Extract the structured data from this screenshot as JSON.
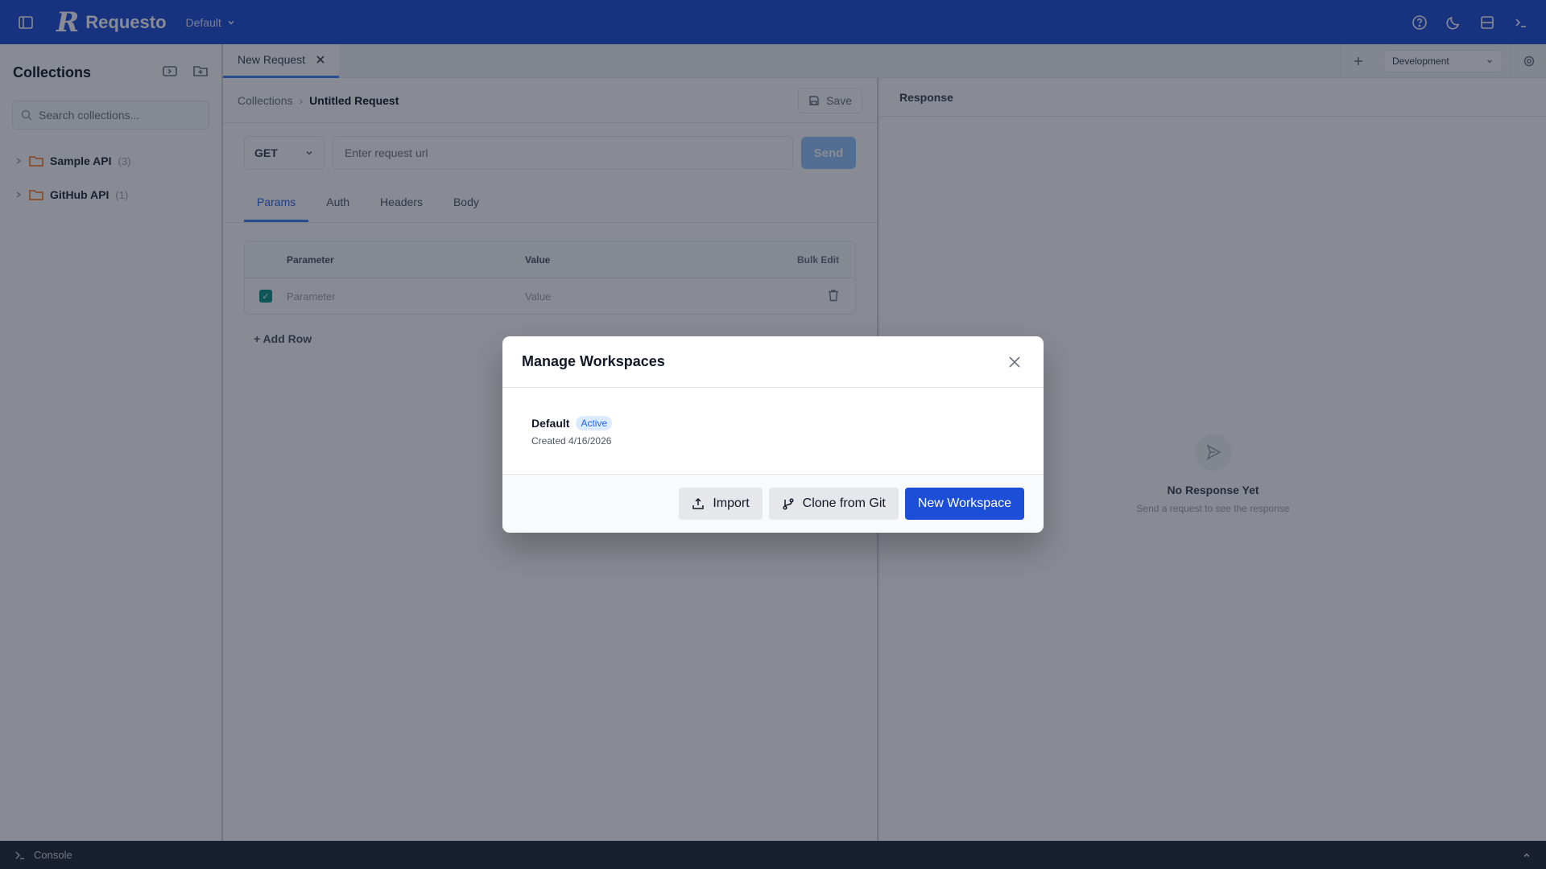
{
  "app": {
    "name": "Requesto",
    "workspace": "Default"
  },
  "sidebar": {
    "title": "Collections",
    "search_placeholder": "Search collections...",
    "items": [
      {
        "label": "Sample API",
        "count": "(3)"
      },
      {
        "label": "GitHub API",
        "count": "(1)"
      }
    ]
  },
  "tabs": [
    {
      "label": "New Request"
    }
  ],
  "environment": {
    "selected": "Development"
  },
  "request": {
    "breadcrumb": [
      "Collections",
      "Untitled Request"
    ],
    "save_label": "Save",
    "method": "GET",
    "url_placeholder": "Enter request url",
    "send_label": "Send",
    "tabs": [
      "Params",
      "Auth",
      "Headers",
      "Body"
    ],
    "params_table": {
      "headers": [
        "Parameter",
        "Value",
        "Bulk Edit"
      ],
      "row": {
        "param_placeholder": "Parameter",
        "value_placeholder": "Value"
      }
    },
    "add_row_label": "+ Add Row"
  },
  "response": {
    "title": "Response",
    "empty_title": "No Response Yet",
    "empty_subtitle": "Send a request to see the response"
  },
  "console": {
    "label": "Console"
  },
  "modal": {
    "title": "Manage Workspaces",
    "workspace": {
      "name": "Default",
      "badge": "Active",
      "created": "Created 4/16/2026"
    },
    "buttons": {
      "import": "Import",
      "clone": "Clone from Git",
      "new": "New Workspace"
    }
  },
  "colors": {
    "brand": "#1d4ed8",
    "accent": "#3b82f6",
    "folder": "#f97316"
  }
}
